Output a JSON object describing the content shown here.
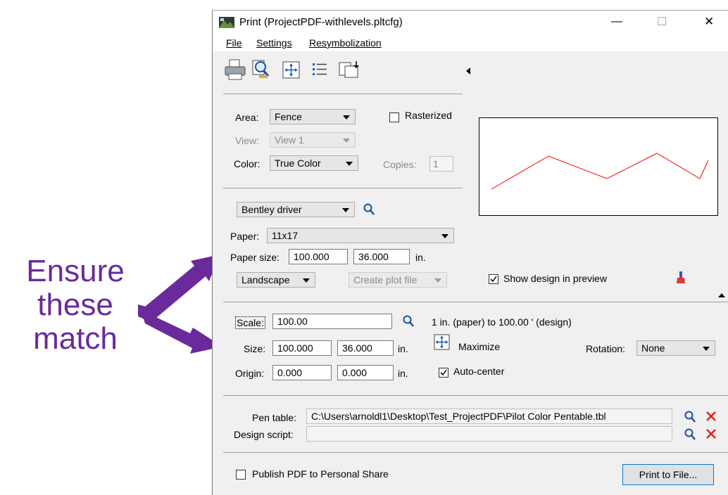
{
  "annotation": {
    "line1": "Ensure",
    "line2": "these",
    "line3": "match"
  },
  "window": {
    "title": "Print  (ProjectPDF-withlevels.pltcfg)",
    "controls": {
      "minimize": "—",
      "maximize": "☐",
      "close": "✕"
    }
  },
  "menu": {
    "file": "File",
    "settings": "Settings",
    "resymbolization": "Resymbolization"
  },
  "toolbar": {
    "icons": [
      "printer-icon",
      "print-preview-icon",
      "fit-icon",
      "list-icon",
      "sheet-icon"
    ]
  },
  "area": {
    "area_label": "Area:",
    "area_value": "Fence",
    "rasterized_label": "Rasterized",
    "rasterized_checked": false,
    "view_label": "View:",
    "view_value": "View 1",
    "color_label": "Color:",
    "color_value": "True Color",
    "copies_label": "Copies:",
    "copies_value": "1"
  },
  "driver": {
    "driver_value": "Bentley driver",
    "paper_label": "Paper:",
    "paper_value": "11x17",
    "paper_size_label": "Paper size:",
    "paper_width": "100.000",
    "paper_height": "36.000",
    "paper_unit": "in.",
    "orientation": "Landscape",
    "create_plot_file": "Create plot file",
    "show_design_label": "Show design in preview",
    "show_design_checked": true
  },
  "scale": {
    "scale_label": "Scale:",
    "scale_value": "100.00",
    "scale_desc": "1 in. (paper) to 100.00 ' (design)",
    "size_label": "Size:",
    "size_width": "100.000",
    "size_height": "36.000",
    "size_unit": "in.",
    "maximize_label": "Maximize",
    "rotation_label": "Rotation:",
    "rotation_value": "None",
    "origin_label": "Origin:",
    "origin_x": "0.000",
    "origin_y": "0.000",
    "origin_unit": "in.",
    "autocenter_label": "Auto-center",
    "autocenter_checked": true
  },
  "pen": {
    "pen_table_label": "Pen table:",
    "pen_table_value": "C:\\Users\\arnoldl1\\Desktop\\Test_ProjectPDF\\Pilot Color Pentable.tbl",
    "design_script_label": "Design script:",
    "design_script_value": ""
  },
  "footer": {
    "publish_label": "Publish PDF to Personal Share",
    "publish_checked": false,
    "print_button": "Print to File..."
  },
  "colors": {
    "annotation": "#6a2a9b",
    "preview_line": "#ff0000",
    "delete": "#e02020"
  }
}
